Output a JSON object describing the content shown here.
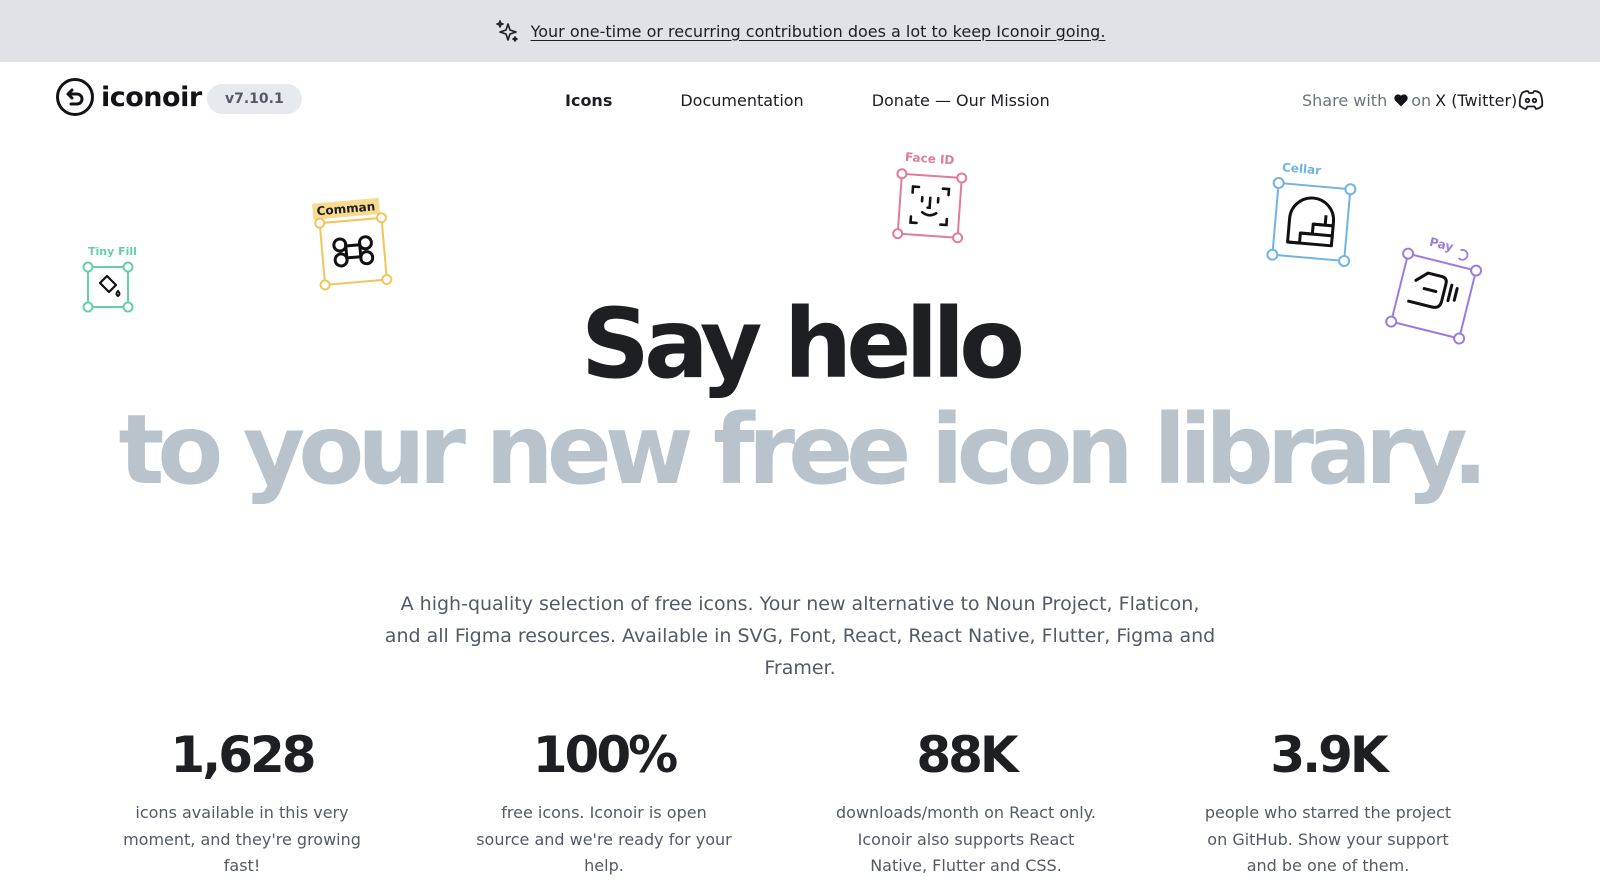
{
  "banner": {
    "icon": "sparks-icon",
    "text": "Your one-time or recurring contribution does a lot to keep Iconoir going."
  },
  "nav": {
    "logo_text": "iconoir",
    "version": "v7.10.1",
    "links": [
      {
        "label": "Icons",
        "active": true
      },
      {
        "label": "Documentation",
        "active": false
      },
      {
        "label": "Donate — Our Mission",
        "active": false
      }
    ],
    "share_prefix": "Share with",
    "share_on": "on",
    "share_target": "X (Twitter)",
    "discord_icon": "discord-icon"
  },
  "floating_icons": [
    {
      "label": "Tiny Fill",
      "icon": "fill-color-icon",
      "color": "#67cfa8"
    },
    {
      "label": "Comman",
      "icon": "command-icon",
      "color": "#f1c55b"
    },
    {
      "label": "Face ID",
      "icon": "face-id-icon",
      "color": "#e07ba0"
    },
    {
      "label": "Cellar",
      "icon": "cellar-icon",
      "color": "#6fb4e5"
    },
    {
      "label": "Pay",
      "icon": "pay-icon",
      "color": "#9a7ce0"
    }
  ],
  "hero": {
    "line1": "Say hello",
    "line2": "to your new free icon library."
  },
  "lead": "A high-quality selection of free icons. Your new alternative to Noun Project, Flaticon, and all Figma resources. Available in SVG, Font, React, React Native, Flutter, Figma and Framer.",
  "stats": [
    {
      "value": "1,628",
      "desc": "icons available in this very moment, and they're growing fast!"
    },
    {
      "value": "100%",
      "desc": "free icons. Iconoir is open source and we're ready for your help."
    },
    {
      "value": "88K",
      "desc": "downloads/month on React only. Iconoir also supports React Native, Flutter and CSS."
    },
    {
      "value": "3.9K",
      "desc": "people who starred the project on GitHub. Show your support and be one of them."
    }
  ]
}
